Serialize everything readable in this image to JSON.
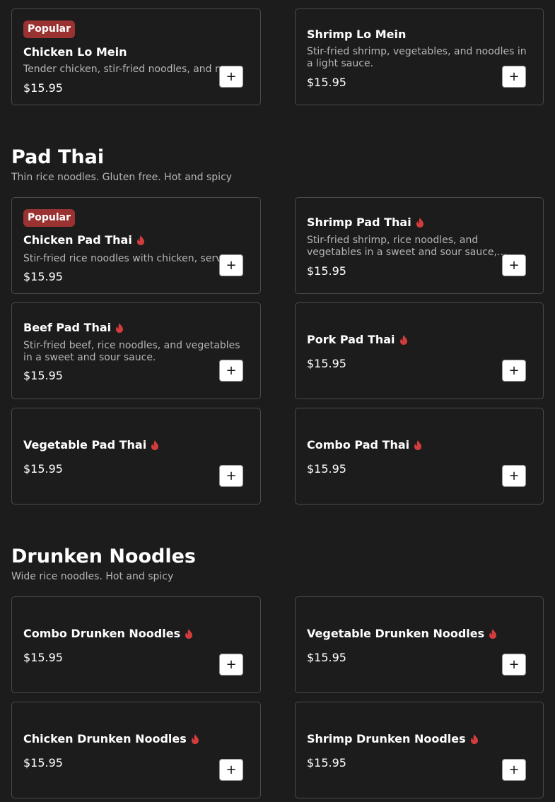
{
  "colors": {
    "background": "#1c1c1c",
    "badge": "#9b3232",
    "flame": "#d23c3c",
    "border": "#4a4a4a"
  },
  "lo_mein": {
    "items": [
      {
        "badge": "Popular",
        "name": "Chicken Lo Mein",
        "desc": "Tender chicken, stir-fried noodles, and mixed vegetables.",
        "price": "$15.95",
        "add": "+"
      },
      {
        "name": "Shrimp Lo Mein",
        "desc": "Stir-fried shrimp, vegetables, and noodles in a light sauce.",
        "price": "$15.95",
        "add": "+"
      }
    ]
  },
  "pad_thai": {
    "title": "Pad Thai",
    "subtitle": "Thin rice noodles. Gluten free. Hot and spicy",
    "items": [
      {
        "badge": "Popular",
        "name": "Chicken Pad Thai",
        "icon": "flame-icon",
        "desc": "Stir-fried rice noodles with chicken, served with crushed peanuts.",
        "price": "$15.95",
        "add": "+"
      },
      {
        "name": "Shrimp Pad Thai",
        "icon": "flame-icon",
        "desc": "Stir-fried shrimp, rice noodles, and vegetables in a sweet and sour sauce, topped with peanuts.",
        "price": "$15.95",
        "add": "+"
      },
      {
        "name": "Beef Pad Thai",
        "icon": "flame-icon",
        "desc": "Stir-fried beef, rice noodles, and vegetables in a sweet and sour sauce.",
        "price": "$15.95",
        "add": "+"
      },
      {
        "name": "Pork Pad Thai",
        "icon": "flame-icon",
        "price": "$15.95",
        "add": "+"
      },
      {
        "name": "Vegetable Pad Thai",
        "icon": "flame-icon",
        "price": "$15.95",
        "add": "+"
      },
      {
        "name": "Combo Pad Thai",
        "icon": "flame-icon",
        "price": "$15.95",
        "add": "+"
      }
    ]
  },
  "drunken_noodles": {
    "title": "Drunken Noodles",
    "subtitle": "Wide rice noodles. Hot and spicy",
    "items": [
      {
        "name": "Combo Drunken Noodles",
        "icon": "flame-icon",
        "price": "$15.95",
        "add": "+"
      },
      {
        "name": "Vegetable Drunken Noodles",
        "icon": "flame-icon",
        "price": "$15.95",
        "add": "+"
      },
      {
        "name": "Chicken Drunken Noodles",
        "icon": "flame-icon",
        "price": "$15.95",
        "add": "+"
      },
      {
        "name": "Shrimp Drunken Noodles",
        "icon": "flame-icon",
        "price": "$15.95",
        "add": "+"
      }
    ]
  }
}
